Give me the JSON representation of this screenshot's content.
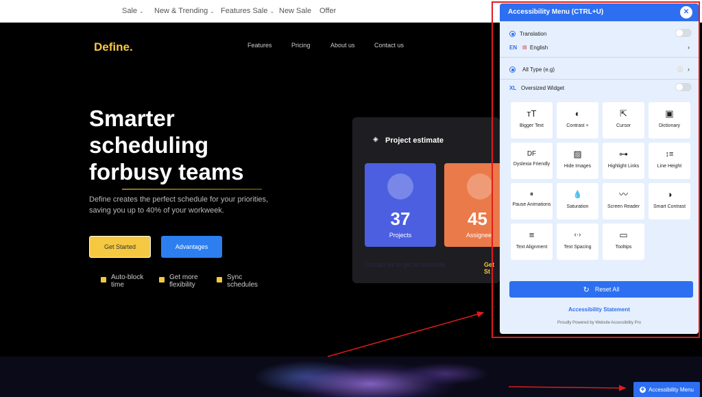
{
  "topnav": [
    {
      "label": "Sale",
      "chev": "⌄"
    },
    {
      "label": "New & Trending",
      "chev": "⌄"
    },
    {
      "label": "Features Sale",
      "chev": "⌄"
    },
    {
      "label": "New Sale",
      "chev": ""
    },
    {
      "label": "Offer",
      "chev": ""
    }
  ],
  "hero": {
    "logo": "Define",
    "logo_dot": ".",
    "nav": [
      "Features",
      "Pricing",
      "About us",
      "Contact us"
    ],
    "headline": "Smarter scheduling forbusy teams",
    "subtitle": "Define creates the perfect schedule for your priorities, saving you up to 40% of your workweek.",
    "btn_start": "Get Started",
    "btn_advantages": "Advantages",
    "features": [
      {
        "l1": "Auto-block",
        "l2": "time"
      },
      {
        "l1": "Get more",
        "l2": "flexibility"
      },
      {
        "l1": "Sync",
        "l2": "schedules"
      }
    ]
  },
  "estimate": {
    "title": "Project estimate",
    "card1_value": "37",
    "card1_label": "Projects",
    "card2_value": "45",
    "card2_label": "Assignee",
    "link_left": "Contact us to get an estimate",
    "link_right": "Get St"
  },
  "panel": {
    "title": "Accessibility Menu (CTRL+U)",
    "close": "✕",
    "translation_label": "Translation",
    "lang_code": "EN",
    "lang_flag": "▤",
    "lang_name": "English",
    "type_label": "All Type (e.g)",
    "oversize_code": "XL",
    "oversize_label": "Oversized Widget",
    "tiles": [
      {
        "icon": "тT",
        "label": "Bigger Text"
      },
      {
        "icon": "◐",
        "label": "Contrast +"
      },
      {
        "icon": "⇱",
        "label": "Cursor"
      },
      {
        "icon": "▣",
        "label": "Dictionary"
      },
      {
        "icon": "DF",
        "label": "Dyslexia Friendly"
      },
      {
        "icon": "▨",
        "label": "Hide Images"
      },
      {
        "icon": "⊶",
        "label": "Highlight Links"
      },
      {
        "icon": "↕≡",
        "label": "Line Height"
      },
      {
        "icon": "⏸",
        "label": "Pause Animations"
      },
      {
        "icon": "💧",
        "label": "Saturation"
      },
      {
        "icon": "〰",
        "label": "Screen Reader"
      },
      {
        "icon": "◑",
        "label": "Smart Contrast"
      },
      {
        "icon": "≡",
        "label": "Text Alignment"
      },
      {
        "icon": "‹·›",
        "label": "Text Spacing"
      },
      {
        "icon": "▭",
        "label": "Tooltips"
      }
    ],
    "reset": "Reset All",
    "statement": "Accessibility Statement",
    "powered": "Proudly Powered by Website Accessibility Pro"
  },
  "launcher": {
    "label": "Accessibility Menu",
    "icon": "✚"
  },
  "colors": {
    "accent": "#2d6ff0",
    "brand_yellow": "#f5c842",
    "annotation_red": "#e01b1b"
  }
}
